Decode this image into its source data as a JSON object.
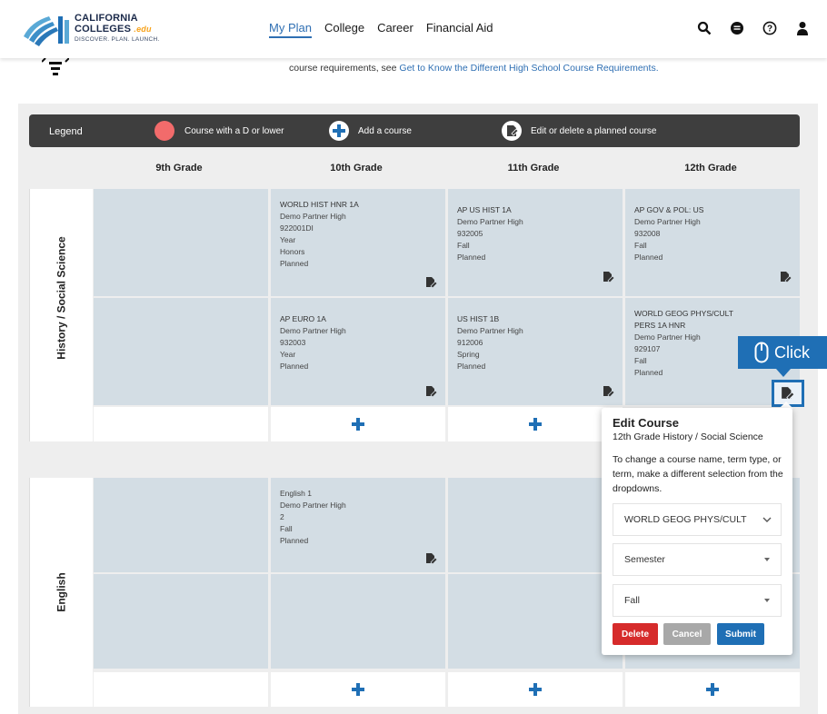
{
  "header": {
    "logo": {
      "line1": "CALIFORNIA",
      "line2": "COLLEGES",
      "edu": ".edu",
      "tagline": "DISCOVER. PLAN. LAUNCH."
    },
    "nav": [
      "My Plan",
      "College",
      "Career",
      "Financial Aid"
    ],
    "active_nav": "My Plan",
    "icons": [
      "search-icon",
      "chat-icon",
      "help-icon",
      "user-icon"
    ]
  },
  "intro": {
    "text": "course requirements, see ",
    "link": "Get to Know the Different High School Course Requirements."
  },
  "legend": {
    "title": "Legend",
    "items": [
      {
        "icon": "red-circle",
        "label": "Course with a D or lower",
        "color": "#f26b6b"
      },
      {
        "icon": "add-icon",
        "label": "Add a course"
      },
      {
        "icon": "edit-icon",
        "label": "Edit or delete a planned course"
      }
    ]
  },
  "grades": [
    "9th Grade",
    "10th Grade",
    "11th Grade",
    "12th Grade"
  ],
  "subjects": [
    {
      "name": "History / Social Science",
      "rows": [
        [
          null,
          {
            "name": "WORLD HIST HNR 1A",
            "school": "Demo Partner High",
            "code": "922001DI",
            "term": "Year",
            "type": "Honors",
            "status": "Planned"
          },
          {
            "name": "AP US HIST 1A",
            "school": "Demo Partner High",
            "code": "932005",
            "term": "Fall",
            "status": "Planned"
          },
          {
            "name": "AP GOV & POL: US",
            "school": "Demo Partner High",
            "code": "932008",
            "term": "Fall",
            "status": "Planned"
          }
        ],
        [
          null,
          {
            "name": "AP EURO 1A",
            "school": "Demo Partner High",
            "code": "932003",
            "term": "Year",
            "status": "Planned"
          },
          {
            "name": "US HIST 1B",
            "school": "Demo Partner High",
            "code": "912006",
            "term": "Spring",
            "status": "Planned"
          },
          {
            "name_line1": "WORLD GEOG PHYS/CULT",
            "name_line2": "PERS 1A HNR",
            "school": "Demo Partner High",
            "code": "929107",
            "term": "Fall",
            "status": "Planned"
          }
        ]
      ]
    },
    {
      "name": "English",
      "rows": [
        [
          null,
          {
            "name": "English 1",
            "school": "Demo Partner High",
            "code": "2",
            "term": "Fall",
            "status": "Planned"
          },
          null,
          null
        ],
        [
          null,
          null,
          null,
          null
        ]
      ]
    }
  ],
  "callout": {
    "label": "Click",
    "icon": "mouse-icon"
  },
  "edit_course": {
    "title": "Edit Course",
    "subtitle": "12th Grade History / Social Science",
    "help": "To change a course name, term type, or term, make a different selection from the dropdowns.",
    "course_select": "WORLD GEOG PHYS/CULT",
    "term_type_select": "Semester",
    "term_select": "Fall",
    "delete_label": "Delete",
    "cancel_label": "Cancel",
    "submit_label": "Submit"
  },
  "colors": {
    "accent": "#1f6fb5",
    "cell_bg": "#d3dde4",
    "delete": "#d62b2b",
    "cancel": "#a8a8a8",
    "legend_bg": "#3e3e3e"
  }
}
